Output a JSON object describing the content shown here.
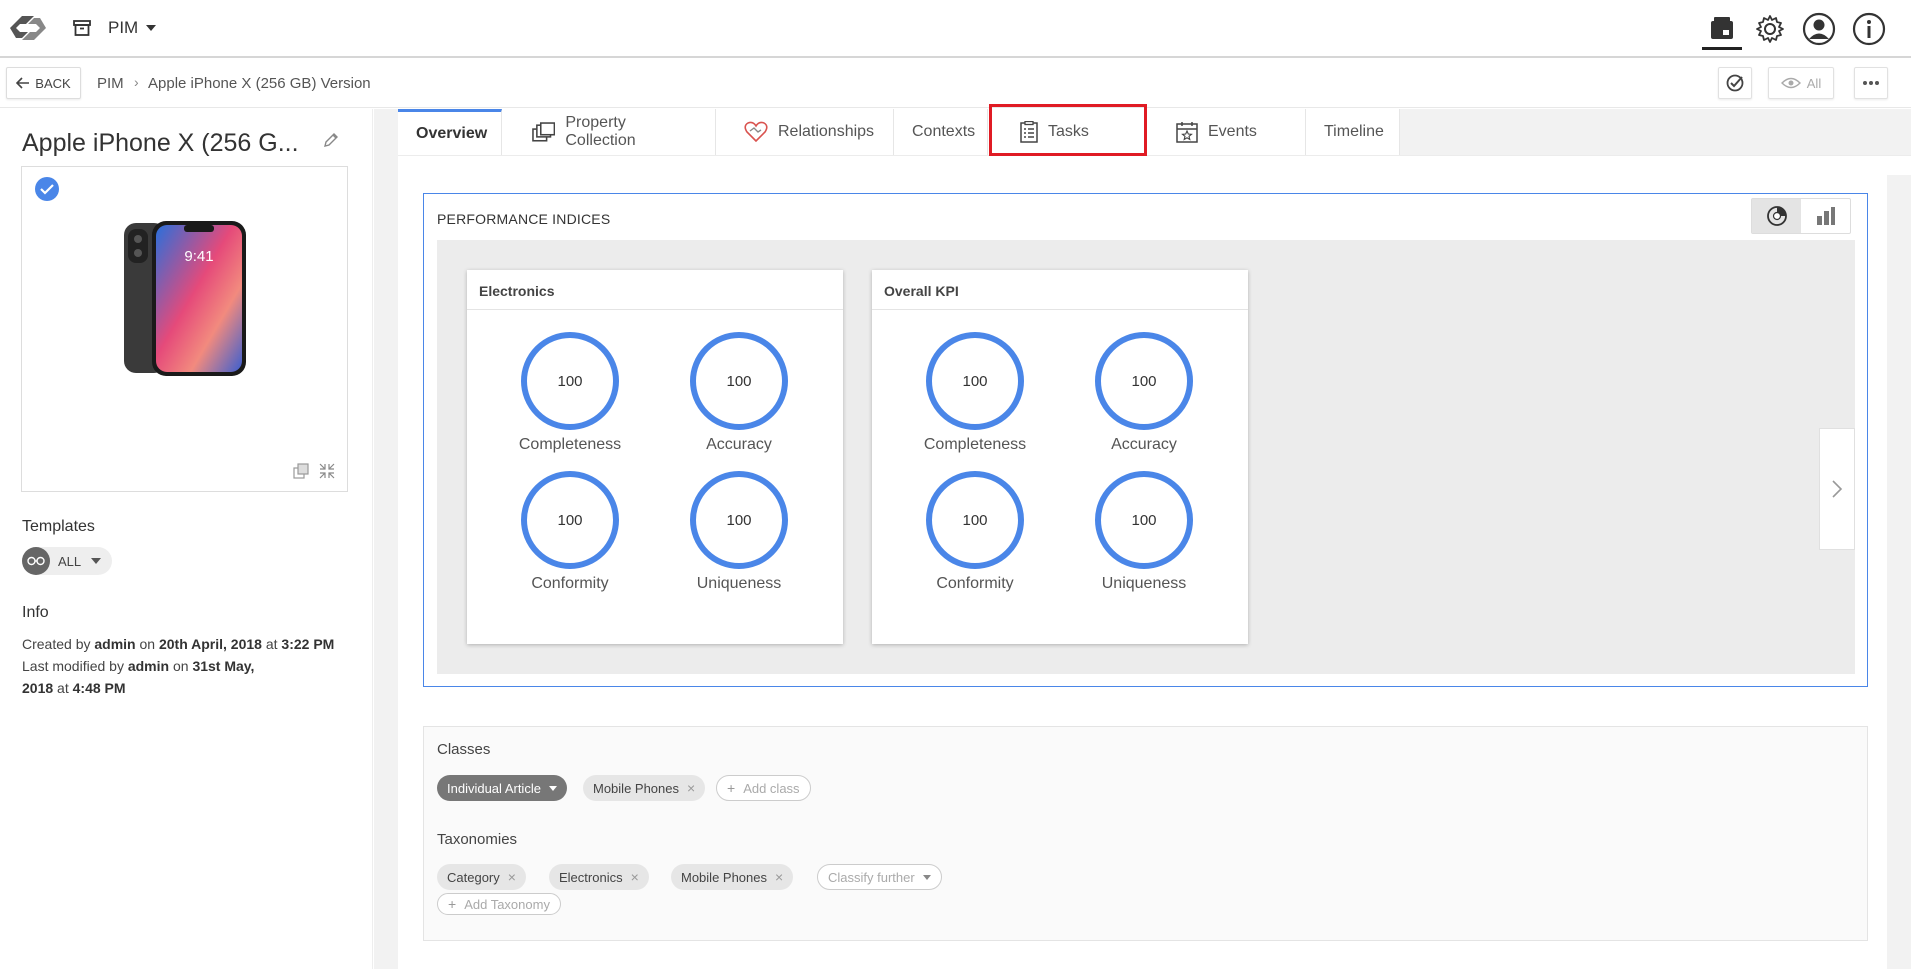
{
  "app": {
    "module": "PIM"
  },
  "breadcrumb": {
    "back_label": "BACK",
    "items": [
      "PIM",
      "Apple iPhone X (256 GB) Version"
    ],
    "view_filter": "All"
  },
  "product": {
    "title": "Apple iPhone X (256 G..."
  },
  "templates": {
    "label": "Templates",
    "selected": "ALL"
  },
  "info": {
    "label": "Info",
    "created_prefix": "Created by",
    "created_by": "admin",
    "created_on_word": "on",
    "created_date": "20th April, 2018",
    "at_word": "at",
    "created_time": "3:22 PM",
    "modified_prefix": "Last modified by",
    "modified_by": "admin",
    "modified_on_word": "on",
    "modified_date_a": "31st May,",
    "modified_date_b": "2018",
    "modified_time": "4:48 PM"
  },
  "tabs": [
    "Overview",
    "Property Collection",
    "Relationships",
    "Contexts",
    "Tasks",
    "Events",
    "Timeline"
  ],
  "performance": {
    "title": "PERFORMANCE INDICES",
    "cards": [
      {
        "title": "Electronics",
        "metrics": [
          {
            "label": "Completeness",
            "value": "100"
          },
          {
            "label": "Accuracy",
            "value": "100"
          },
          {
            "label": "Conformity",
            "value": "100"
          },
          {
            "label": "Uniqueness",
            "value": "100"
          }
        ]
      },
      {
        "title": "Overall KPI",
        "metrics": [
          {
            "label": "Completeness",
            "value": "100"
          },
          {
            "label": "Accuracy",
            "value": "100"
          },
          {
            "label": "Conformity",
            "value": "100"
          },
          {
            "label": "Uniqueness",
            "value": "100"
          }
        ]
      }
    ]
  },
  "classes": {
    "label": "Classes",
    "primary": "Individual Article",
    "items": [
      "Mobile Phones"
    ],
    "add_label": "Add class"
  },
  "taxonomies": {
    "label": "Taxonomies",
    "items": [
      "Category",
      "Electronics",
      "Mobile Phones"
    ],
    "classify_label": "Classify further",
    "add_label": "Add Taxonomy"
  },
  "colors": {
    "accent": "#4a86e8",
    "highlight": "#e01b24"
  }
}
